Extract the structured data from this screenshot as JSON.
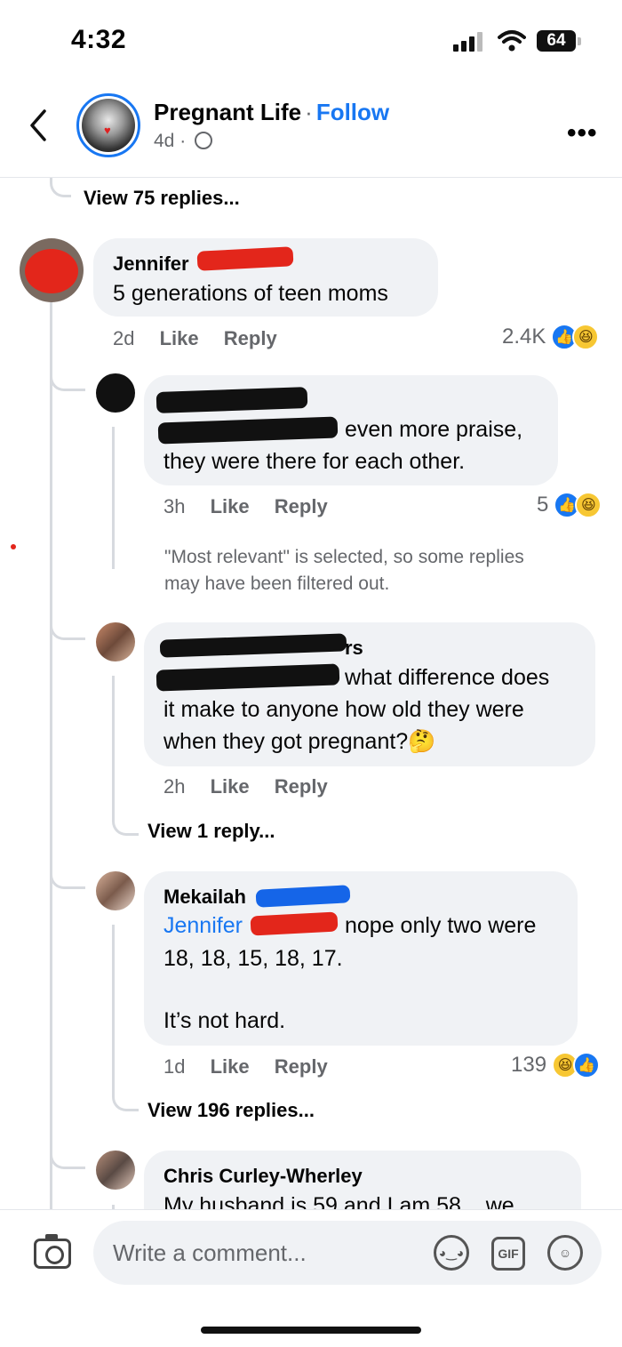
{
  "status_bar": {
    "time": "4:32",
    "battery": "64"
  },
  "header": {
    "page_name": "Pregnant Life",
    "separator": "·",
    "follow_label": "Follow",
    "post_age": "4d ·"
  },
  "thread": {
    "view_75": "View 75 replies...",
    "comment1": {
      "author": "Jennifer",
      "text": "5 generations of teen moms",
      "time": "2d",
      "like": "Like",
      "reply": "Reply",
      "reactions": "2.4K"
    },
    "reply1": {
      "text_line1": "even more praise,",
      "text_line2": "they were there for each other.",
      "time": "3h",
      "like": "Like",
      "reply": "Reply",
      "reactions": "5"
    },
    "filter_note_line1": "\"Most relevant\" is selected, so some replies",
    "filter_note_line2": "may have been filtered out.",
    "reply2": {
      "author_suffix": "rs",
      "text_line1": "what difference does",
      "text_line2": "it make to anyone how old they were",
      "text_line3": "when they got pregnant?",
      "emoji": "🤔",
      "time": "2h",
      "like": "Like",
      "reply": "Reply"
    },
    "view_1": "View 1 reply...",
    "reply3": {
      "author": "Mekailah",
      "mention": "Jennifer",
      "text_line1": "nope only two were",
      "text_line2": "18, 18, 15, 18, 17.",
      "text_line3": "It’s not hard.",
      "time": "1d",
      "like": "Like",
      "reply": "Reply",
      "reactions": "139"
    },
    "view_196": "View 196 replies...",
    "reply4": {
      "author": "Chris Curley-Wherley",
      "text_line1": "My husband is 59 and I am 58... we"
    }
  },
  "composer": {
    "placeholder": "Write a comment...",
    "gif_label": "GIF"
  },
  "icons": {
    "back": "chevron-left-icon",
    "more": "more-icon",
    "globe": "globe-icon",
    "camera": "camera-icon",
    "avatar_sticker": "sticker-icon",
    "gif": "gif-icon",
    "emoji": "emoji-icon"
  },
  "colors": {
    "accent": "#1877f2",
    "bubble": "#f0f2f5",
    "muted": "#65676b"
  }
}
